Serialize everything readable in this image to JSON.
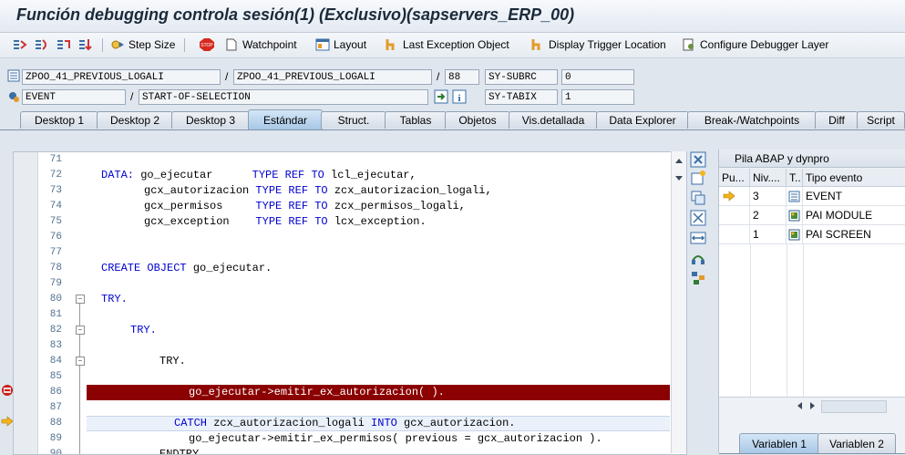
{
  "window": {
    "title": "Función debugging controla sesión(1)  (Exclusivo)(sapservers_ERP_00)"
  },
  "toolbar": {
    "step_size": "Step Size",
    "watchpoint": "Watchpoint",
    "layout": "Layout",
    "last_exception": "Last Exception Object",
    "display_trigger": "Display Trigger Location",
    "configure_layer": "Configure Debugger Layer"
  },
  "info": {
    "program1": "ZPOO_41_PREVIOUS_LOGALI",
    "program2": "ZPOO_41_PREVIOUS_LOGALI",
    "line": "88",
    "subrc_label": "SY-SUBRC",
    "subrc_value": "0",
    "event_type": "EVENT",
    "event_name": "START-OF-SELECTION",
    "tabix_label": "SY-TABIX",
    "tabix_value": "1",
    "slash": "/"
  },
  "tabs": [
    "Desktop 1",
    "Desktop 2",
    "Desktop 3",
    "Estándar",
    "Struct.",
    "Tablas",
    "Objetos",
    "Vis.detallada",
    "Data Explorer",
    "Break-/Watchpoints",
    "Diff",
    "Script"
  ],
  "code": {
    "l71": {
      "num": "71"
    },
    "l72": {
      "num": "72",
      "kw1": "DATA:",
      "t1": " go_ejecutar      ",
      "kw2": "TYPE REF TO",
      "t2": " lcl_ejecutar,"
    },
    "l73": {
      "num": "73",
      "t1": "gcx_autorizacion ",
      "kw1": "TYPE REF TO",
      "t2": " zcx_autorizacion_logali,"
    },
    "l74": {
      "num": "74",
      "t1": "gcx_permisos     ",
      "kw1": "TYPE REF TO",
      "t2": " zcx_permisos_logali,"
    },
    "l75": {
      "num": "75",
      "t1": "gcx_exception    ",
      "kw1": "TYPE REF TO",
      "t2": " lcx_exception."
    },
    "l76": {
      "num": "76"
    },
    "l77": {
      "num": "77"
    },
    "l78": {
      "num": "78",
      "kw1": "CREATE OBJECT",
      "t1": " go_ejecutar."
    },
    "l79": {
      "num": "79"
    },
    "l80": {
      "num": "80",
      "kw1": "TRY."
    },
    "l81": {
      "num": "81"
    },
    "l82": {
      "num": "82",
      "kw1": "TRY."
    },
    "l83": {
      "num": "83"
    },
    "l84": {
      "num": "84",
      "t1": "TRY."
    },
    "l85": {
      "num": "85"
    },
    "l86": {
      "num": "86",
      "t1": "go_ejecutar->emitir_ex_autorizacion( )."
    },
    "l87": {
      "num": "87"
    },
    "l88": {
      "num": "88",
      "kw1": "CATCH",
      "t1": " zcx_autorizacion_logali ",
      "kw2": "INTO",
      "t2": " gcx_autorizacion."
    },
    "l89": {
      "num": "89",
      "t1": "go_ejecutar->emitir_ex_permisos( previous = gcx_autorizacion )."
    },
    "l90": {
      "num": "90",
      "t1": "ENDTRY."
    }
  },
  "stack_panel": {
    "title": "Pila ABAP y dynpro",
    "headers": [
      "Pu...",
      "Niv....",
      "T..",
      "Tipo evento"
    ],
    "rows": [
      {
        "level": "3",
        "event": "EVENT"
      },
      {
        "level": "2",
        "event": "PAI MODULE"
      },
      {
        "level": "1",
        "event": "PAI SCREEN"
      }
    ],
    "tabs": [
      "Variablen 1",
      "Variablen 2"
    ]
  },
  "colors": {
    "breakpoint_line": "#8b0000",
    "keyword": "#0000d0",
    "active_tab": "#a8c8e6"
  }
}
